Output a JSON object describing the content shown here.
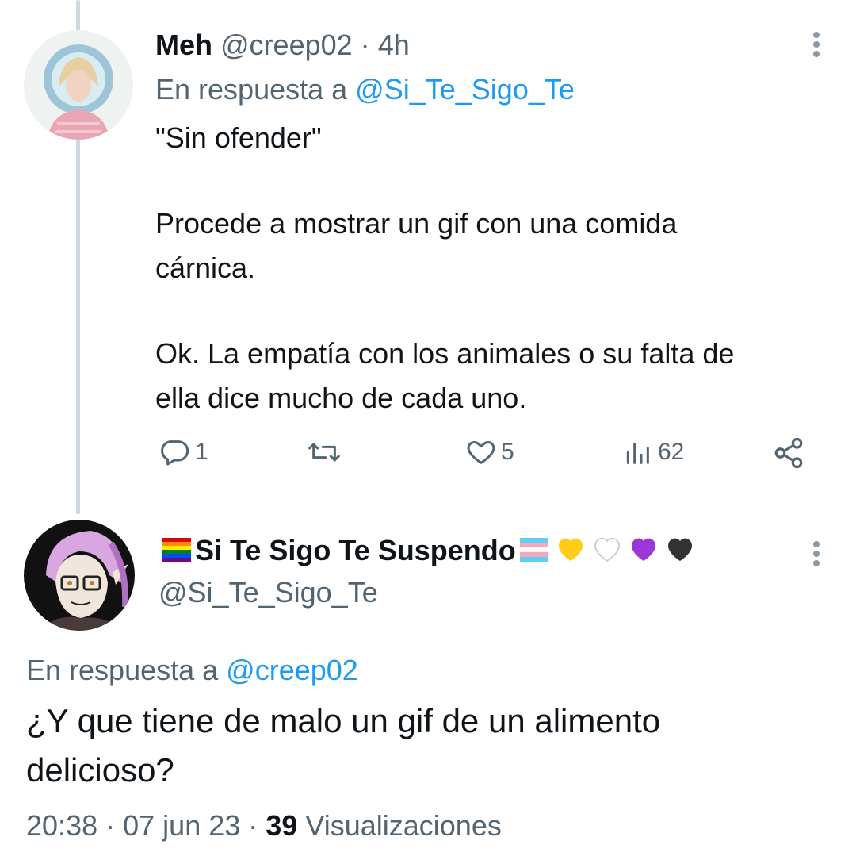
{
  "tweet1": {
    "display_name": "Meh",
    "handle": "@creep02",
    "separator": "·",
    "time": "4h",
    "reply_prefix": "En respuesta a",
    "reply_to": "@Si_Te_Sigo_Te",
    "lines": [
      "\"Sin ofender\"",
      "Procede a mostrar un gif con una comida",
      "cárnica.",
      "Ok. La empatía con los animales o su falta de",
      "ella dice mucho de cada uno."
    ],
    "actions": {
      "reply_count": "1",
      "retweet_count": "",
      "like_count": "5",
      "views_count": "62"
    }
  },
  "tweet2": {
    "display_name": "Si Te Sigo Te Suspendo",
    "handle": "@Si_Te_Sigo_Te",
    "reply_prefix": "En respuesta a",
    "reply_to": "@creep02",
    "lines": [
      "¿Y que tiene de malo un gif de un alimento",
      "delicioso?"
    ],
    "time": "20:38",
    "separator1": "·",
    "date": "07 jun 23",
    "separator2": "·",
    "views_count": "39",
    "views_label": "Visualizaciones"
  },
  "icons": {
    "reply": "reply-icon",
    "retweet": "retweet-icon",
    "like": "heart-icon",
    "views": "views-icon",
    "share": "share-icon",
    "more": "more-dots-icon"
  },
  "colors": {
    "accent": "#1d9bf0",
    "secondary_text": "#536471",
    "thread_line": "#cfd9de"
  }
}
